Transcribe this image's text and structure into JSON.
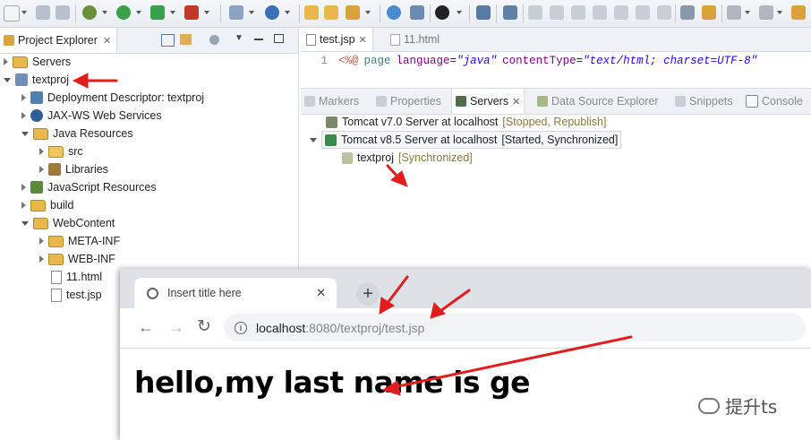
{
  "toolbar": {
    "icons": [
      "new-icon",
      "save-icon",
      "save-all-icon",
      "debug-icon",
      "run-icon",
      "run-config-icon",
      "external-tools-icon",
      "new-server-icon",
      "new-class-icon",
      "open-type-icon",
      "open-task-icon",
      "search-icon",
      "globe-icon",
      "back-icon",
      "forward-icon"
    ]
  },
  "explorer": {
    "tab_label": "Project Explorer",
    "items": [
      {
        "label": "Servers"
      },
      {
        "label": "textproj"
      },
      {
        "label": "Deployment Descriptor: textproj"
      },
      {
        "label": "JAX-WS Web Services"
      },
      {
        "label": "Java Resources"
      },
      {
        "label": "src"
      },
      {
        "label": "Libraries"
      },
      {
        "label": "JavaScript Resources"
      },
      {
        "label": "build"
      },
      {
        "label": "WebContent"
      },
      {
        "label": "META-INF"
      },
      {
        "label": "WEB-INF"
      },
      {
        "label": "11.html"
      },
      {
        "label": "test.jsp"
      }
    ]
  },
  "editor": {
    "tabs": [
      {
        "label": "test.jsp"
      },
      {
        "label": "11.html"
      }
    ],
    "line_number": "1",
    "code": {
      "open": "<%@",
      "kw": "page",
      "a1": "language",
      "v1": "\"java\"",
      "a2": "contentType",
      "v2": "\"text/html; charset=UTF-8\""
    }
  },
  "views": {
    "tabs": [
      {
        "label": "Markers"
      },
      {
        "label": "Properties"
      },
      {
        "label": "Servers"
      },
      {
        "label": "Data Source Explorer"
      },
      {
        "label": "Snippets"
      },
      {
        "label": "Console"
      }
    ],
    "servers": [
      {
        "name": "Tomcat v7.0 Server at localhost",
        "status": "[Stopped, Republish]"
      },
      {
        "name": "Tomcat v8.5 Server at localhost",
        "status": "[Started, Synchronized]"
      }
    ],
    "module": {
      "name": "textproj",
      "status": "[Synchronized]"
    }
  },
  "browser": {
    "tab_title": "Insert title here",
    "url_host": "localhost",
    "url_rest": ":8080/textproj/test.jsp",
    "heading": "hello,my last name is ge"
  },
  "watermark": {
    "text": "提升ts"
  },
  "colors": {
    "accent_red": "#e31d1d",
    "string_blue": "#2a00ff",
    "attr_purple": "#7f0055",
    "status_olive": "#8b7a3a"
  }
}
